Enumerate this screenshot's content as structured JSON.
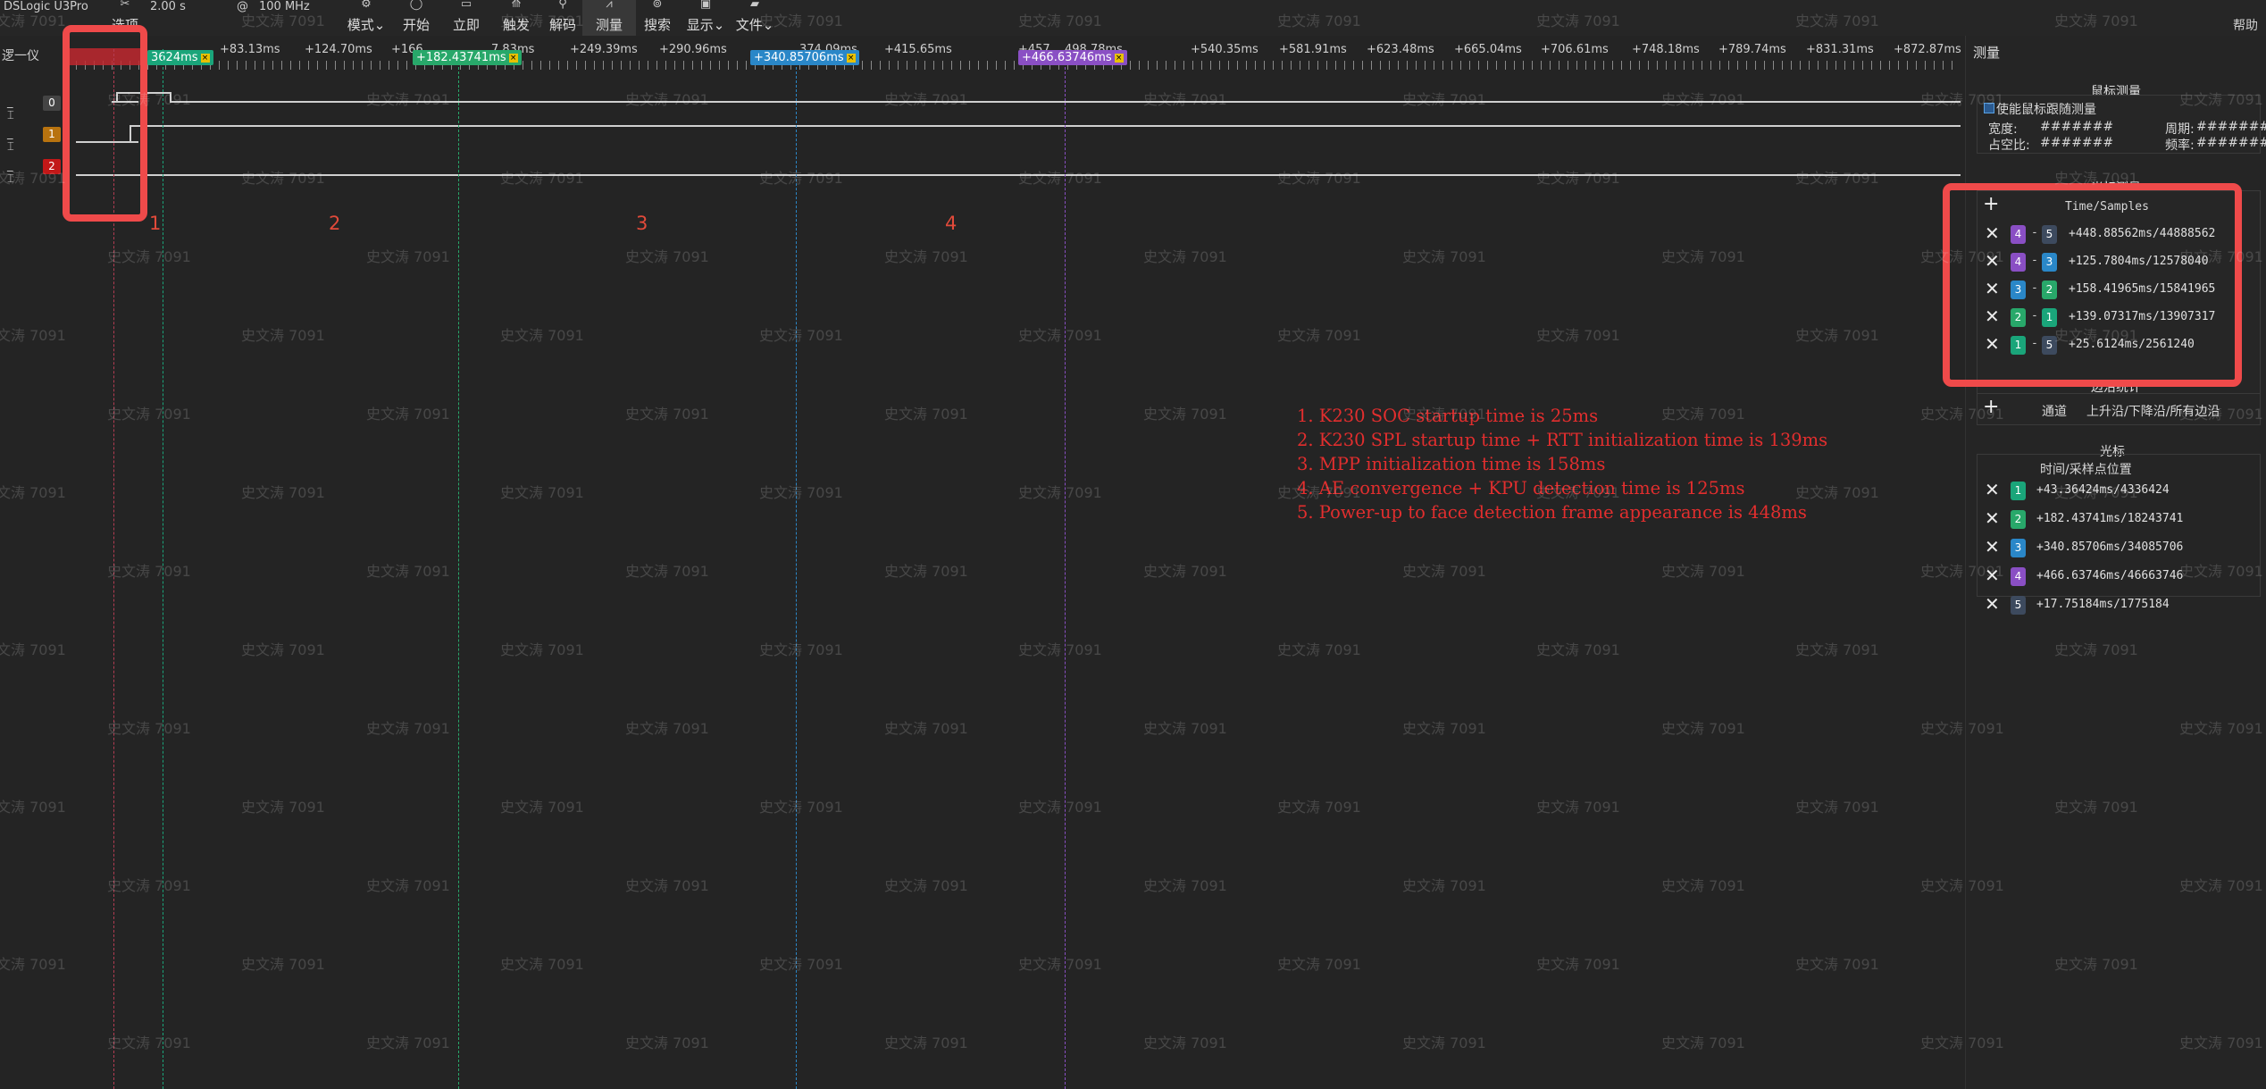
{
  "toolbar": {
    "device": "DSLogic U3Pro",
    "sample_time": "2.00 s",
    "at": "@",
    "sample_rate": "100 MHz",
    "options_label": "选项",
    "buttons": [
      {
        "label": "模式⌄",
        "icon": "mode-icon"
      },
      {
        "label": "开始",
        "icon": "start-icon"
      },
      {
        "label": "立即",
        "icon": "instant-icon"
      },
      {
        "label": "触发",
        "icon": "trigger-icon"
      },
      {
        "label": "解码",
        "icon": "decode-icon"
      },
      {
        "label": "测量",
        "icon": "measure-icon"
      },
      {
        "label": "搜索",
        "icon": "search-icon"
      },
      {
        "label": "显示⌄",
        "icon": "display-icon"
      },
      {
        "label": "文件⌄",
        "icon": "file-icon"
      }
    ],
    "help_label": "帮助"
  },
  "ruler": {
    "left_label": "逻一仪",
    "ticks": [
      "+83.13ms",
      "+124.70ms",
      "+166.",
      "7.83ms",
      "+249.39ms",
      "+290.96ms",
      "374.09ms",
      "+415.65ms",
      "+457.",
      "498.78ms",
      "+540.35ms",
      "+581.91ms",
      "+623.48ms",
      "+665.04ms",
      "+706.61ms",
      "+748.18ms",
      "+789.74ms",
      "+831.31ms",
      "+872.87ms"
    ],
    "cursor_tags": [
      {
        "label": "3624ms",
        "color": "#1aa57a"
      },
      {
        "label": "+182.43741ms",
        "color": "#28a86a"
      },
      {
        "label": "+340.85706ms",
        "color": "#2a87c8"
      },
      {
        "label": "+466.63746ms",
        "color": "#8a4fc4"
      }
    ]
  },
  "channels": [
    {
      "index": "0",
      "color": "#444444",
      "symbol": "_ ⌶"
    },
    {
      "index": "1",
      "color": "#b8730f",
      "symbol": "_ ⌶"
    },
    {
      "index": "2",
      "color": "#c21818",
      "symbol": "_ ⌶"
    }
  ],
  "regions": [
    "1",
    "2",
    "3",
    "4"
  ],
  "notes": [
    "1. K230 SOC startup time is 25ms",
    "2. K230 SPL startup time + RTT initialization time is 139ms",
    "3. MPP initialization time is 158ms",
    "4. AE convergence + KPU detection time is 125ms",
    "5. Power-up to face detection frame appearance is 448ms"
  ],
  "panel": {
    "header": "测量",
    "mouse_section": {
      "title": "鼠标测量",
      "enable_label": "使能鼠标跟随测量",
      "width_label": "宽度:",
      "width_value": "#######",
      "period_label": "周期:",
      "period_value": "#######",
      "duty_label": "占空比:",
      "duty_value": "#######",
      "freq_label": "频率:",
      "freq_value": "#######"
    },
    "cursor_measure": {
      "title": "光标测量",
      "column": "Time/Samples",
      "rows": [
        {
          "a": "4",
          "b": "5",
          "a_color": "#8a4fc4",
          "b_color": "#3d4a5e",
          "value": "+448.88562ms/44888562"
        },
        {
          "a": "4",
          "b": "3",
          "a_color": "#8a4fc4",
          "b_color": "#2a87c8",
          "value": "+125.7804ms/12578040"
        },
        {
          "a": "3",
          "b": "2",
          "a_color": "#2a87c8",
          "b_color": "#28a86a",
          "value": "+158.41965ms/15841965"
        },
        {
          "a": "2",
          "b": "1",
          "a_color": "#28a86a",
          "b_color": "#1aa57a",
          "value": "+139.07317ms/13907317"
        },
        {
          "a": "1",
          "b": "5",
          "a_color": "#1aa57a",
          "b_color": "#3d4a5e",
          "value": "+25.6124ms/2561240"
        }
      ]
    },
    "edge_stats": {
      "title": "边沿统计",
      "channel_label": "通道",
      "edges_label": "上升沿/下降沿/所有边沿"
    },
    "cursors": {
      "title": "光标",
      "column": "时间/采样点位置",
      "rows": [
        {
          "id": "1",
          "color": "#1aa57a",
          "value": "+43.36424ms/4336424"
        },
        {
          "id": "2",
          "color": "#28a86a",
          "value": "+182.43741ms/18243741"
        },
        {
          "id": "3",
          "color": "#2a87c8",
          "value": "+340.85706ms/34085706"
        },
        {
          "id": "4",
          "color": "#8a4fc4",
          "value": "+466.63746ms/46663746"
        },
        {
          "id": "5",
          "color": "#3d4a5e",
          "value": "+17.75184ms/1775184"
        }
      ]
    }
  },
  "watermark": "史文涛 7091"
}
